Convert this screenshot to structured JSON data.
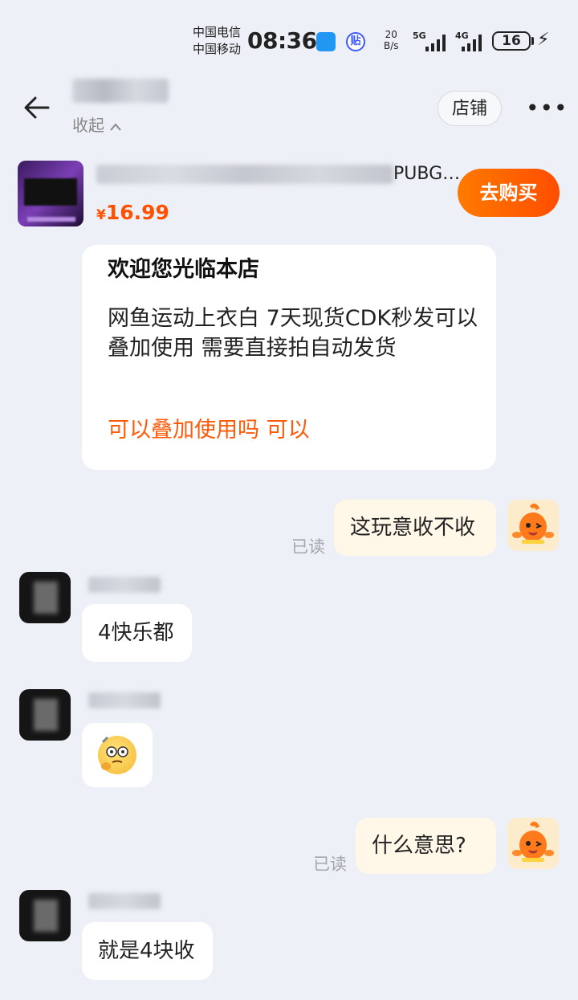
{
  "status_bar": {
    "carrier_1": "中国电信",
    "carrier_2": "中国移动",
    "time": "08:36",
    "net_speed_value": "20",
    "net_speed_unit": "B/s",
    "sig_1": "5G",
    "sig_2": "4G",
    "battery": "16"
  },
  "header": {
    "collapse_label": "收起",
    "shop_button": "店铺"
  },
  "product": {
    "title_tail": "PUBG…",
    "price_symbol": "¥",
    "price": "16.99",
    "buy_button": "去购买"
  },
  "welcome_card": {
    "title": "欢迎您光临本店",
    "body": "网鱼运动上衣白 7天现货CDK秒发可以叠加使用 需要直接拍自动发货",
    "link": "可以叠加使用吗 可以"
  },
  "messages": [
    {
      "side": "right",
      "text": "这玩意收不收",
      "status": "已读"
    },
    {
      "side": "left",
      "text": "4快乐都"
    },
    {
      "side": "left",
      "text": "",
      "emoji": "thinking-face-emoji"
    },
    {
      "side": "right",
      "text": "什么意思?",
      "status": "已读"
    },
    {
      "side": "left",
      "text": "就是4块收"
    }
  ]
}
